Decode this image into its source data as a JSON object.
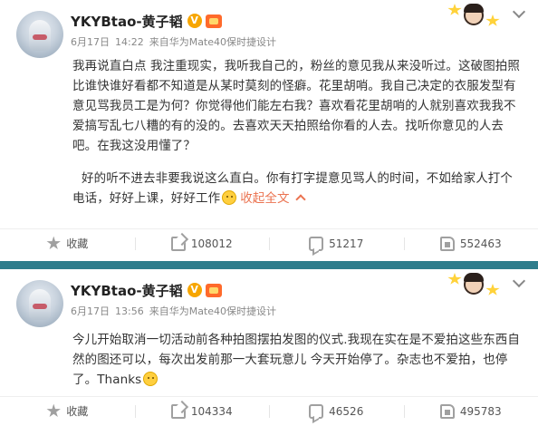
{
  "posts": [
    {
      "username": "YKYBtao-黄子韬",
      "verified_badge": "V",
      "date": "6月17日",
      "time": "14:22",
      "source": "来自华为Mate40保时捷设计",
      "paragraph1": "我再说直白点 我注重现实，我听我自己的，粉丝的意见我从来没听过。这破图拍照比谁快谁好看都不知道是从某时莫刻的怪癖。花里胡哨。我自己决定的衣服发型有意见骂我员工是为何？你觉得他们能左右我？喜欢看花里胡哨的人就别喜欢我我不爱搞写乱七八糟的有的没的。去喜欢天天拍照给你看的人去。找听你意见的人去吧。在我这没用懂了？",
      "paragraph2": "好的听不进去非要我说这么直白。你有打字提意见骂人的时间，不如给家人打个电话，好好上课，好好工作",
      "collapse_label": "收起全文",
      "actions": {
        "favorite_label": "收藏",
        "share_count": "108012",
        "comment_count": "51217",
        "like_count": "552463"
      }
    },
    {
      "username": "YKYBtao-黄子韬",
      "verified_badge": "V",
      "date": "6月17日",
      "time": "13:56",
      "source": "来自华为Mate40保时捷设计",
      "paragraph1": "今儿开始取消一切活动前各种拍图摆拍发图的仪式.我现在实在是不爱拍这些东西自然的图还可以，每次出发前那一大套玩意儿 今天开始停了。杂志也不爱拍，也停了。Thanks",
      "actions": {
        "favorite_label": "收藏",
        "share_count": "104334",
        "comment_count": "46526",
        "like_count": "495783"
      }
    }
  ],
  "icons": {
    "favorite": "star-icon",
    "share": "share-icon",
    "comment": "comment-icon",
    "like": "like-icon",
    "more": "chevron-down-icon",
    "emoji": "smile-emoji-icon",
    "verified": "verified-v-icon",
    "vip": "vip-badge-icon"
  },
  "colors": {
    "link": "#eb7350",
    "badge": "#f7a600",
    "divider": "#2e7d8c"
  }
}
